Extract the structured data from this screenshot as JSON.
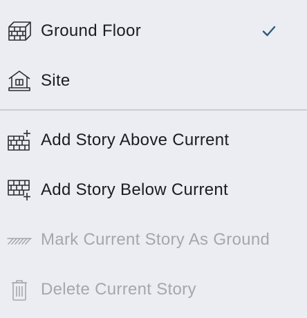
{
  "colors": {
    "background": "#ebedf2",
    "text": "#1b1d21",
    "disabled_text": "#a4a7ad",
    "icon": "#2a2c30",
    "disabled_icon": "#a4a7ad",
    "checkmark": "#2a5a7a",
    "divider": "#c9ccd2"
  },
  "menu": {
    "stories": [
      {
        "label": "Ground Floor",
        "icon": "brick-wall-icon",
        "selected": true
      },
      {
        "label": "Site",
        "icon": "house-site-icon",
        "selected": false
      }
    ],
    "actions": [
      {
        "label": "Add Story Above Current",
        "icon": "add-story-above-icon",
        "enabled": true
      },
      {
        "label": "Add Story Below Current",
        "icon": "add-story-below-icon",
        "enabled": true
      },
      {
        "label": "Mark Current Story As Ground",
        "icon": "ground-hatch-icon",
        "enabled": false
      },
      {
        "label": "Delete Current Story",
        "icon": "trash-icon",
        "enabled": false
      }
    ]
  }
}
